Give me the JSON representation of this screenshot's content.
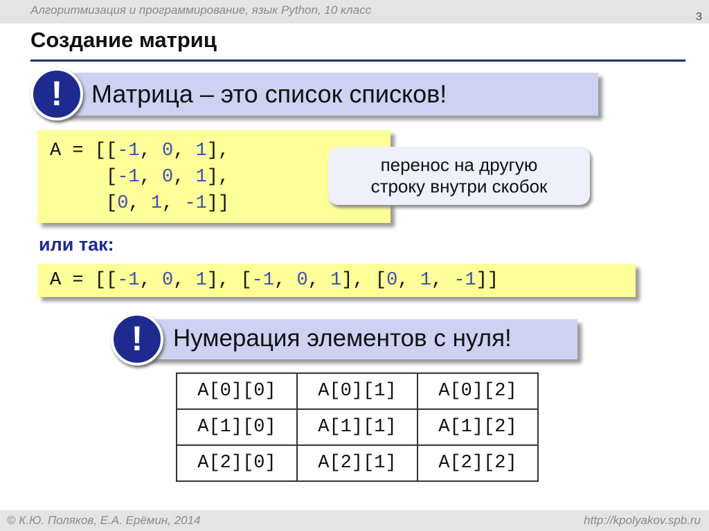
{
  "header": {
    "course": "Алгоритмизация и программирование, язык Python, 10 класс",
    "slide_number": "3"
  },
  "title": "Создание матриц",
  "callout1": {
    "mark": "!",
    "text": "Матрица – это список списков!"
  },
  "code1": {
    "lines": [
      [
        {
          "t": "A",
          "num": false
        },
        {
          "t": " = [[",
          "num": false
        },
        {
          "t": "-1",
          "num": true
        },
        {
          "t": ", ",
          "num": false
        },
        {
          "t": "0",
          "num": true
        },
        {
          "t": ", ",
          "num": false
        },
        {
          "t": "1",
          "num": true
        },
        {
          "t": "],",
          "num": false
        }
      ],
      [
        {
          "t": "     [",
          "num": false
        },
        {
          "t": "-1",
          "num": true
        },
        {
          "t": ", ",
          "num": false
        },
        {
          "t": "0",
          "num": true
        },
        {
          "t": ", ",
          "num": false
        },
        {
          "t": "1",
          "num": true
        },
        {
          "t": "],",
          "num": false
        }
      ],
      [
        {
          "t": "     [",
          "num": false
        },
        {
          "t": "0",
          "num": true
        },
        {
          "t": ", ",
          "num": false
        },
        {
          "t": "1",
          "num": true
        },
        {
          "t": ", ",
          "num": false
        },
        {
          "t": "-1",
          "num": true
        },
        {
          "t": "]]",
          "num": false
        }
      ]
    ]
  },
  "bubble": {
    "line1": "перенос на другую",
    "line2": "строку внутри скобок"
  },
  "or_label": "или так:",
  "code2": {
    "line": [
      {
        "t": "A",
        "num": false
      },
      {
        "t": " = [[",
        "num": false
      },
      {
        "t": "-1",
        "num": true
      },
      {
        "t": ", ",
        "num": false
      },
      {
        "t": "0",
        "num": true
      },
      {
        "t": ", ",
        "num": false
      },
      {
        "t": "1",
        "num": true
      },
      {
        "t": "], [",
        "num": false
      },
      {
        "t": "-1",
        "num": true
      },
      {
        "t": ", ",
        "num": false
      },
      {
        "t": "0",
        "num": true
      },
      {
        "t": ", ",
        "num": false
      },
      {
        "t": "1",
        "num": true
      },
      {
        "t": "], [",
        "num": false
      },
      {
        "t": "0",
        "num": true
      },
      {
        "t": ", ",
        "num": false
      },
      {
        "t": "1",
        "num": true
      },
      {
        "t": ", ",
        "num": false
      },
      {
        "t": "-1",
        "num": true
      },
      {
        "t": "]]",
        "num": false
      }
    ]
  },
  "callout2": {
    "mark": "!",
    "text": "Нумерация элементов с нуля!"
  },
  "index_table": [
    [
      "A[0][0]",
      "A[0][1]",
      "A[0][2]"
    ],
    [
      "A[1][0]",
      "A[1][1]",
      "A[1][2]"
    ],
    [
      "A[2][0]",
      "A[2][1]",
      "A[2][2]"
    ]
  ],
  "footer": {
    "copyright": "© К.Ю. Поляков, Е.А. Ерёмин, 2014",
    "url": "http://kpolyakov.spb.ru"
  },
  "colors": {
    "accent": "#1e2a8e",
    "callout": "#cdd2f2",
    "code_background": "#ffff9a",
    "number": "#3b4fa8"
  }
}
